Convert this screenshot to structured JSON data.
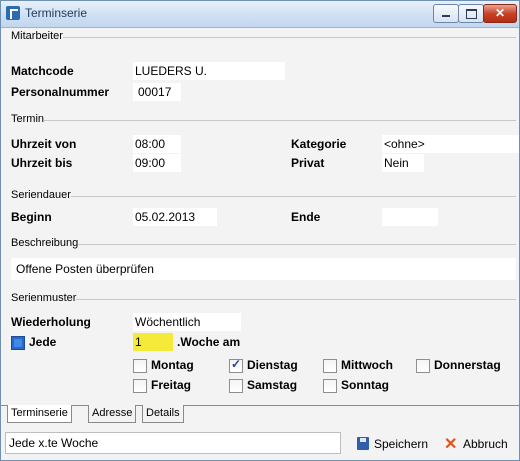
{
  "window": {
    "title": "Terminserie"
  },
  "mitarbeiter": {
    "group_title": "Mitarbeiter",
    "matchcode_label": "Matchcode",
    "matchcode_value": "LUEDERS U.",
    "personalnummer_label": "Personalnummer",
    "personalnummer_value": "00017"
  },
  "termin": {
    "group_title": "Termin",
    "uhrzeit_von_label": "Uhrzeit von",
    "uhrzeit_von_value": "08:00",
    "uhrzeit_bis_label": "Uhrzeit bis",
    "uhrzeit_bis_value": "09:00",
    "kategorie_label": "Kategorie",
    "kategorie_value": "<ohne>",
    "privat_label": "Privat",
    "privat_value": "Nein"
  },
  "seriendauer": {
    "group_title": "Seriendauer",
    "beginn_label": "Beginn",
    "beginn_value": "05.02.2013",
    "ende_label": "Ende",
    "ende_value": ""
  },
  "beschreibung": {
    "group_title": "Beschreibung",
    "value": "Offene Posten überprüfen"
  },
  "serienmuster": {
    "group_title": "Serienmuster",
    "wiederholung_label": "Wiederholung",
    "wiederholung_value": "Wöchentlich",
    "jede_label": "Jede",
    "jede_checked": true,
    "interval_value": "1",
    "woche_am_label": ".Woche am",
    "days": [
      {
        "label": "Montag",
        "checked": false
      },
      {
        "label": "Dienstag",
        "checked": true
      },
      {
        "label": "Mittwoch",
        "checked": false
      },
      {
        "label": "Donnerstag",
        "checked": false
      },
      {
        "label": "Freitag",
        "checked": false
      },
      {
        "label": "Samstag",
        "checked": false
      },
      {
        "label": "Sonntag",
        "checked": false
      }
    ]
  },
  "tabs": [
    "Terminserie",
    "Adresse",
    "Details"
  ],
  "status_text": "Jede x.te Woche",
  "buttons": {
    "save": "Speichern",
    "cancel": "Abbruch"
  },
  "icons": {
    "app": "app-logo-icon",
    "save": "floppy-disk-icon",
    "cancel": "red-x-icon"
  },
  "colors": {
    "highlight": "#f5e93a",
    "cancel_icon": "#e25320",
    "save_icon": "#2f5fab"
  }
}
